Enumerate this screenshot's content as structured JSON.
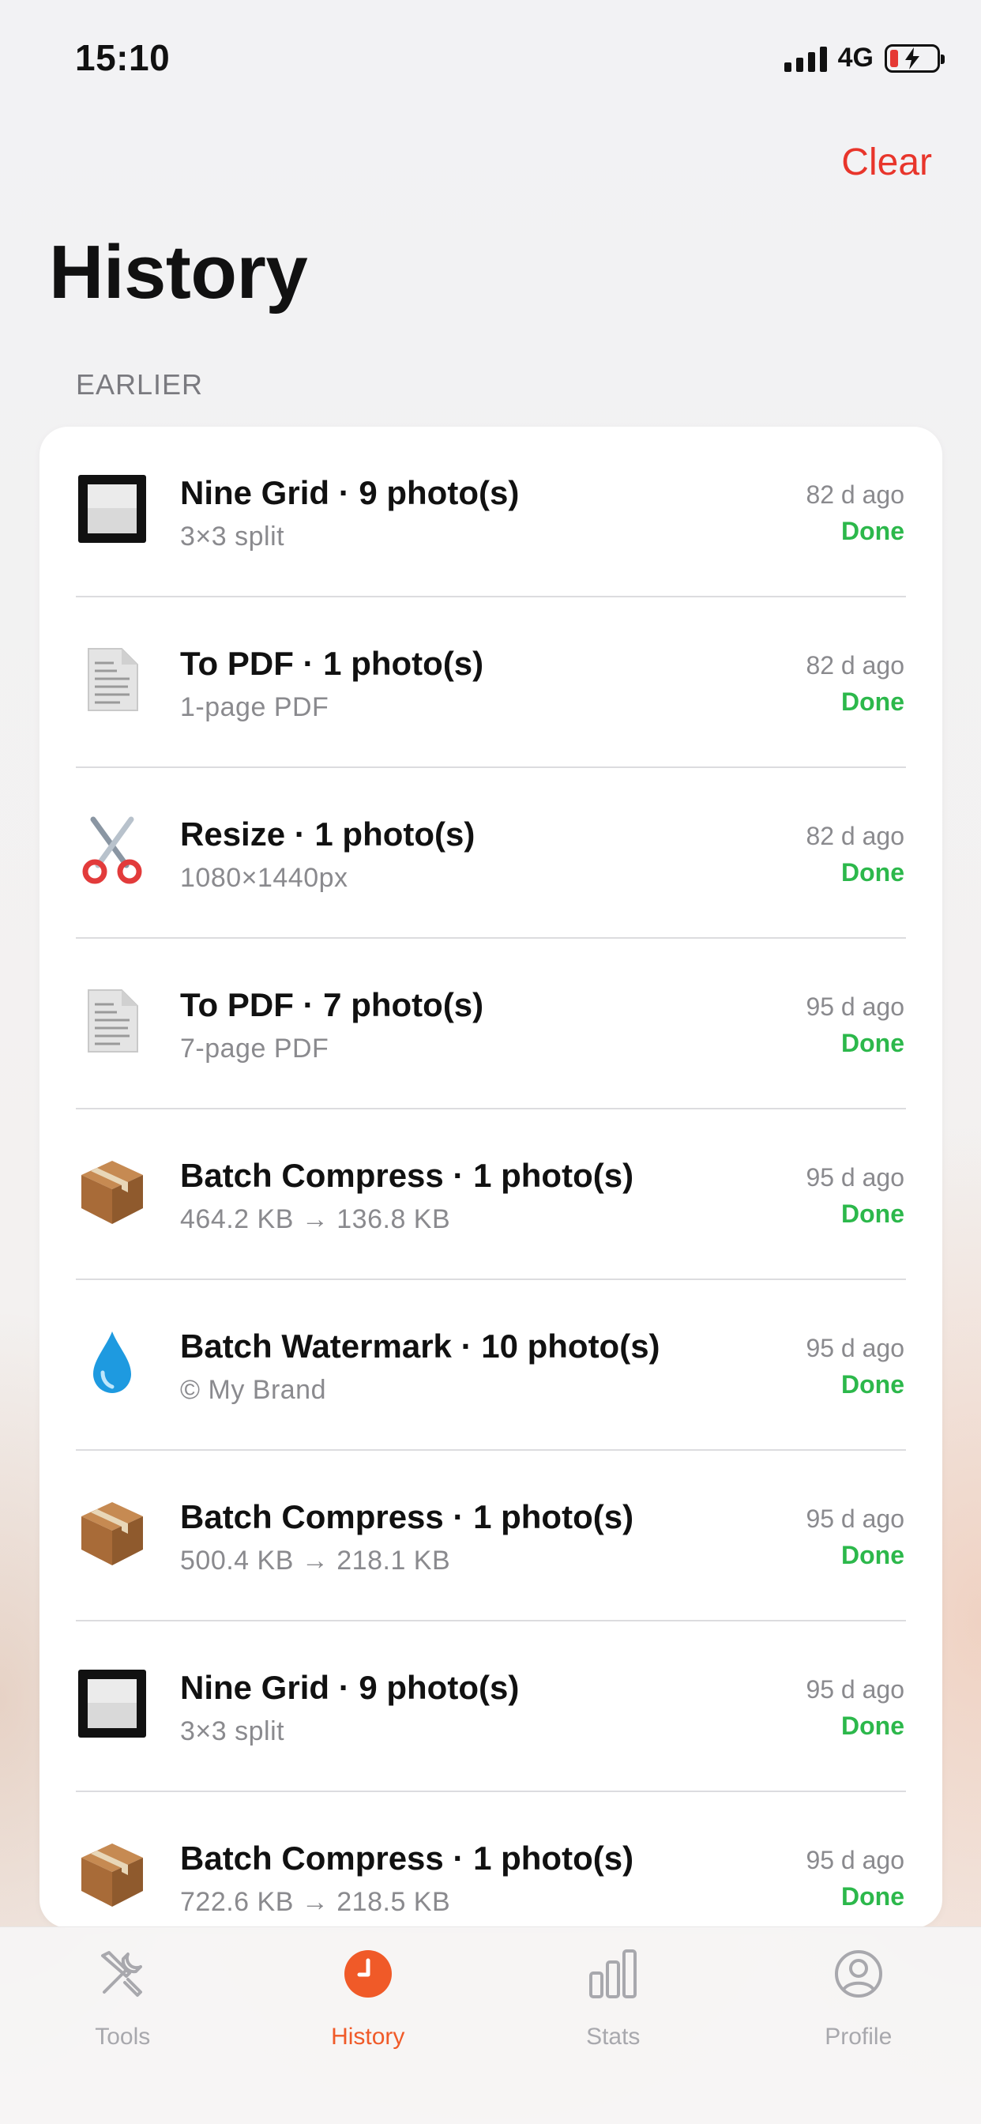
{
  "status_bar": {
    "time": "15:10",
    "network": "4G"
  },
  "header": {
    "clear_label": "Clear",
    "title": "History"
  },
  "section": {
    "label": "EARLIER"
  },
  "history": [
    {
      "icon": "nine-grid-icon",
      "title": "Nine Grid · 9 photo(s)",
      "subtitle": "3×3 split",
      "time": "82 d ago",
      "status": "Done"
    },
    {
      "icon": "document-icon",
      "title": "To PDF · 1 photo(s)",
      "subtitle": "1-page PDF",
      "time": "82 d ago",
      "status": "Done"
    },
    {
      "icon": "scissors-icon",
      "title": "Resize · 1 photo(s)",
      "subtitle": "1080×1440px",
      "time": "82 d ago",
      "status": "Done"
    },
    {
      "icon": "document-icon",
      "title": "To PDF · 7 photo(s)",
      "subtitle": "7-page PDF",
      "time": "95 d ago",
      "status": "Done"
    },
    {
      "icon": "package-icon",
      "title": "Batch Compress · 1 photo(s)",
      "subtitle": "464.2 KB → 136.8 KB",
      "time": "95 d ago",
      "status": "Done"
    },
    {
      "icon": "droplet-icon",
      "title": "Batch Watermark · 10 photo(s)",
      "subtitle": "© My Brand",
      "time": "95 d ago",
      "status": "Done"
    },
    {
      "icon": "package-icon",
      "title": "Batch Compress · 1 photo(s)",
      "subtitle": "500.4 KB → 218.1 KB",
      "time": "95 d ago",
      "status": "Done"
    },
    {
      "icon": "nine-grid-icon",
      "title": "Nine Grid · 9 photo(s)",
      "subtitle": "3×3 split",
      "time": "95 d ago",
      "status": "Done"
    },
    {
      "icon": "package-icon",
      "title": "Batch Compress · 1 photo(s)",
      "subtitle": "722.6 KB → 218.5 KB",
      "time": "95 d ago",
      "status": "Done"
    }
  ],
  "tabs": [
    {
      "name": "tools",
      "label": "Tools",
      "icon": "tools-icon",
      "active": false
    },
    {
      "name": "history",
      "label": "History",
      "icon": "clock-icon",
      "active": true
    },
    {
      "name": "stats",
      "label": "Stats",
      "icon": "bar-chart-icon",
      "active": false
    },
    {
      "name": "profile",
      "label": "Profile",
      "icon": "profile-icon",
      "active": false
    }
  ],
  "colors": {
    "accent": "#f05a28",
    "destructive": "#e8352b",
    "success": "#2cb84b",
    "muted": "#8a8a8e"
  }
}
